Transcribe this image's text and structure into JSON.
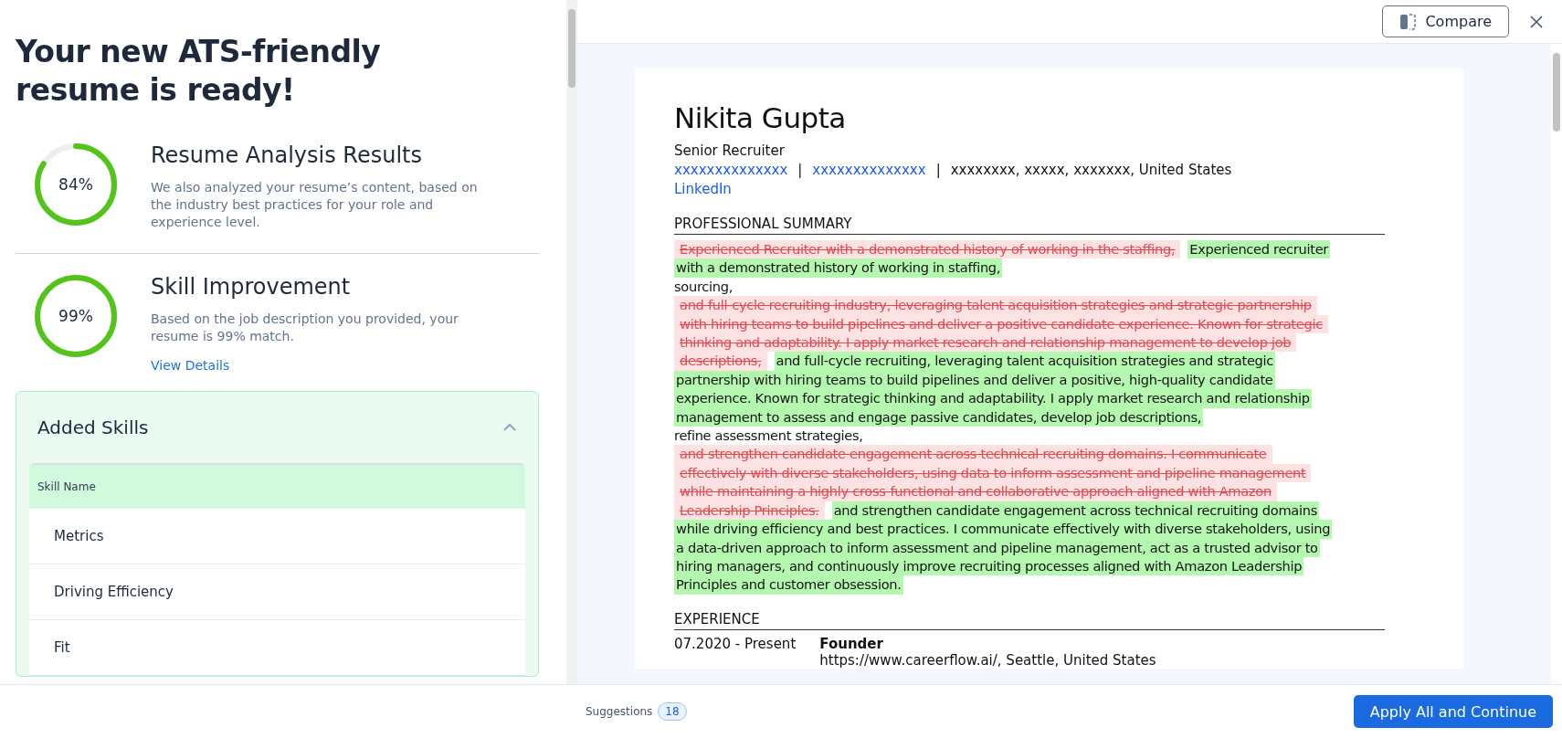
{
  "left_panel": {
    "title": "Your new ATS-friendly resume is ready!",
    "scores": [
      {
        "value": "84%",
        "title": "Resume Analysis Results",
        "description": "We also analyzed your resume’s content, based on the industry best practices for your role and experience level."
      },
      {
        "value": "99%",
        "title": "Skill Improvement",
        "description": "Based on the job description you provided, your resume is 99% match.",
        "link": "View Details"
      }
    ],
    "added_skills": {
      "title": "Added Skills",
      "expanded": true,
      "column": "Skill Name",
      "rows": [
        "Metrics",
        "Driving Efficiency",
        "Fit"
      ]
    }
  },
  "toolbar": {
    "compare_button": "Compare"
  },
  "resume": {
    "name": "Nikita Gupta",
    "role": "Senior Recruiter",
    "contact": [
      {
        "text": "xxxxxxxxxxxxxx",
        "link": true
      },
      {
        "text": "|",
        "link": false
      },
      {
        "text": "xxxxxxxxxxxxxx",
        "link": true
      },
      {
        "text": "|",
        "link": false
      },
      {
        "text": "xxxxxxxx, xxxxx, xxxxxxx, United States",
        "link": false
      }
    ],
    "linkedin": "LinkedIn",
    "summary_heading": "PROFESSIONAL SUMMARY",
    "summary_lines": [
      [
        {
          "kind": "deleted",
          "text": "Experienced Recruiter with a demonstrated history of working in the staffing,"
        },
        {
          "kind": "added",
          "text": "Experienced recruiter"
        }
      ],
      [
        {
          "kind": "added",
          "text": "with a demonstrated history of working in staffing,"
        }
      ],
      [
        {
          "kind": "plain",
          "text": "sourcing,"
        }
      ],
      [
        {
          "kind": "deleted",
          "text": "and full-cycle recruiting industry, leveraging talent acquisition strategies and strategic partnership"
        }
      ],
      [
        {
          "kind": "deleted",
          "text": "with hiring teams to build pipelines and deliver a positive candidate experience. Known for strategic"
        }
      ],
      [
        {
          "kind": "deleted",
          "text": "thinking and adaptability. I apply market research and relationship management to develop job"
        }
      ],
      [
        {
          "kind": "deleted",
          "text": "descriptions,"
        },
        {
          "kind": "added",
          "text": "and full-cycle recruiting, leveraging talent acquisition strategies and strategic"
        }
      ],
      [
        {
          "kind": "added",
          "text": "partnership with hiring teams to build pipelines and deliver a positive, high-quality candidate"
        }
      ],
      [
        {
          "kind": "added",
          "text": "experience. Known for strategic thinking and adaptability. I apply market research and relationship"
        }
      ],
      [
        {
          "kind": "added",
          "text": "management to assess and engage passive candidates, develop job descriptions,"
        }
      ],
      [
        {
          "kind": "plain",
          "text": "refine assessment strategies,"
        }
      ],
      [
        {
          "kind": "deleted",
          "text": "and strengthen candidate engagement across technical recruiting domains. I communicate"
        }
      ],
      [
        {
          "kind": "deleted",
          "text": "effectively with diverse stakeholders, using data to inform assessment and pipeline management"
        }
      ],
      [
        {
          "kind": "deleted",
          "text": "while maintaining a highly cross-functional and collaborative approach aligned with Amazon"
        }
      ],
      [
        {
          "kind": "deleted",
          "text": "Leadership Principles."
        },
        {
          "kind": "added",
          "text": "and strengthen candidate engagement across technical recruiting domains"
        }
      ],
      [
        {
          "kind": "added",
          "text": "while driving efficiency and best practices. I communicate effectively with diverse stakeholders, using"
        }
      ],
      [
        {
          "kind": "added",
          "text": "a data-driven approach to inform assessment and pipeline management, act as a trusted advisor to"
        }
      ],
      [
        {
          "kind": "added",
          "text": "hiring managers, and continuously improve recruiting processes aligned with Amazon Leadership"
        }
      ],
      [
        {
          "kind": "added",
          "text": "Principles and customer obsession."
        }
      ]
    ],
    "experience_heading": "EXPERIENCE",
    "experience": [
      {
        "dates": "07.2020 - Present",
        "title": "Founder",
        "detail": "https://www.careerflow.ai/, Seattle, United States"
      }
    ]
  },
  "footer": {
    "suggestions_label": "Suggestions",
    "suggestions_count": "18",
    "apply_button": "Apply All and Continue"
  }
}
